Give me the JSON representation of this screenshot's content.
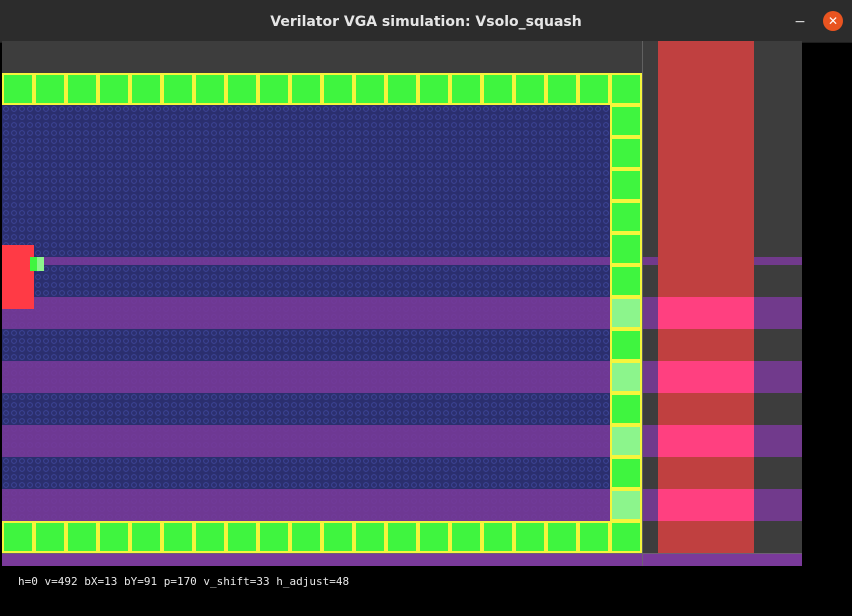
{
  "window": {
    "title": "Verilator VGA simulation: Vsolo_squash",
    "minimize_icon": "minimize-icon",
    "close_icon": "close-icon",
    "minimize_glyph": "−",
    "close_glyph": "✕"
  },
  "colors": {
    "title_bar": "#2c2c2c",
    "court_blue": "#2b2f6e",
    "stripe_purple": "#7a3a9a",
    "wall_green": "#3ff53f",
    "wall_light": "#8cf58c",
    "wall_border": "#f5f53c",
    "paddle_red": "#ff3a45",
    "ball": "#8cf58c",
    "side_red": "#c04040",
    "side_pink": "#ff4080",
    "grey": "#3d3d3d"
  },
  "status": {
    "debug_line": "h=0 v=492 bX=13 bY=91 p=170 v_shift=33 h_adjust=48"
  }
}
